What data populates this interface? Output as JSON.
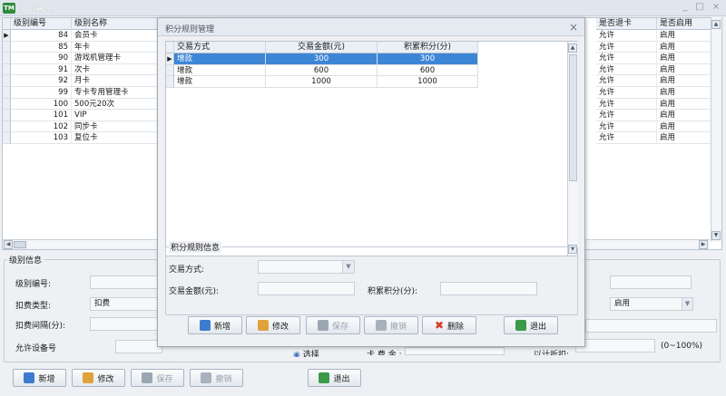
{
  "window": {
    "title": "级别管理",
    "app_icon_text": "TM",
    "minimize": "_",
    "maximize": "□",
    "close": "×"
  },
  "grid": {
    "columns": [
      "级别编号",
      "级别名称",
      "是否退卡",
      "是否启用"
    ],
    "rows": [
      {
        "id": "84",
        "name": "会员卡",
        "refund": "允许",
        "enabled": "启用"
      },
      {
        "id": "85",
        "name": "年卡",
        "refund": "允许",
        "enabled": "启用"
      },
      {
        "id": "90",
        "name": "游戏机管理卡",
        "refund": "允许",
        "enabled": "启用"
      },
      {
        "id": "91",
        "name": "次卡",
        "refund": "允许",
        "enabled": "启用"
      },
      {
        "id": "92",
        "name": "月卡",
        "refund": "允许",
        "enabled": "启用"
      },
      {
        "id": "99",
        "name": "专卡专用管理卡",
        "refund": "允许",
        "enabled": "启用"
      },
      {
        "id": "100",
        "name": "500元20次",
        "refund": "允许",
        "enabled": "启用"
      },
      {
        "id": "101",
        "name": "VIP",
        "refund": "允许",
        "enabled": "启用"
      },
      {
        "id": "102",
        "name": "同步卡",
        "refund": "允许",
        "enabled": "启用"
      },
      {
        "id": "103",
        "name": "复位卡",
        "refund": "允许",
        "enabled": "启用"
      }
    ]
  },
  "level_info": {
    "group_title": "级别信息",
    "id_label": "级别编号:",
    "discount_type_label": "扣费类型:",
    "discount_type_value": "扣费",
    "interval_label": "扣费间隔(分):",
    "device_label": "允许设备号",
    "select_button": "选择",
    "partial_label_1": "卡 费 金 :",
    "partial_label_2": "以计折扣:",
    "discount_range": "(0~100%)",
    "enabled_value": "启用"
  },
  "main_buttons": {
    "add": "新增",
    "edit": "修改",
    "save": "保存",
    "cancel": "撤销",
    "exit": "退出"
  },
  "dialog": {
    "title": "积分规则管理",
    "close": "×",
    "columns": [
      "交易方式",
      "交易金额(元)",
      "积累积分(分)"
    ],
    "rows": [
      {
        "method": "增款",
        "amount": "300",
        "points": "300"
      },
      {
        "method": "增款",
        "amount": "600",
        "points": "600"
      },
      {
        "method": "增款",
        "amount": "1000",
        "points": "1000"
      }
    ],
    "info_group_title": "积分规则信息",
    "method_label": "交易方式:",
    "amount_label": "交易金额(元):",
    "points_label": "积累积分(分):",
    "buttons": {
      "add": "新增",
      "edit": "修改",
      "save": "保存",
      "cancel": "撤销",
      "delete": "删除",
      "exit": "退出"
    }
  },
  "colors": {
    "selection": "#3d86d6",
    "add_icon": "#3c7bd0",
    "edit_icon": "#e0a23a",
    "delete_icon": "#d83a2a",
    "exit_icon": "#3b9a4a"
  }
}
